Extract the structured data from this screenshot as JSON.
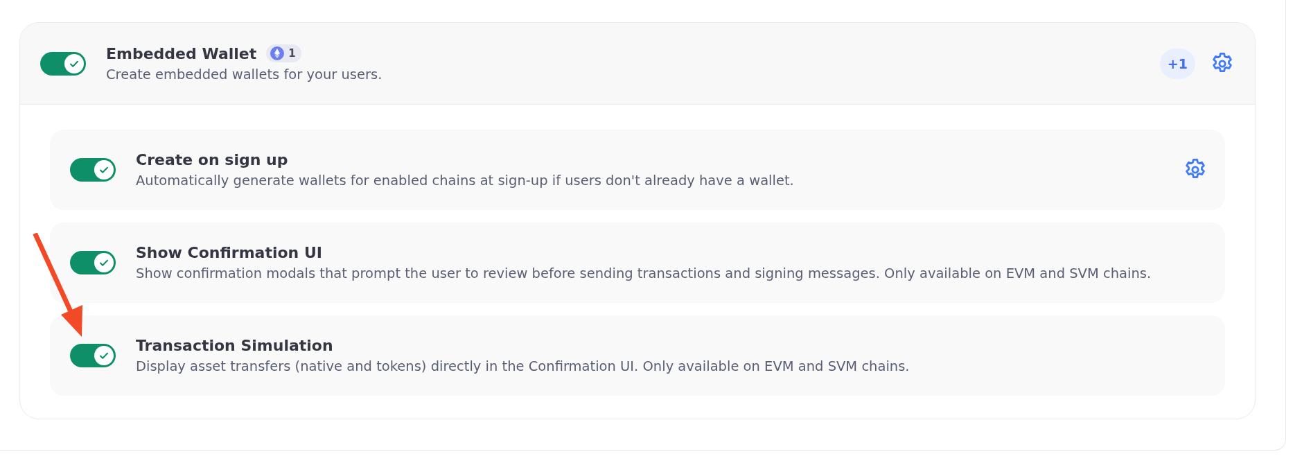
{
  "wallet": {
    "title": "Embedded Wallet",
    "on": true,
    "chain_count": "1",
    "description": "Create embedded wallets for your users.",
    "extra_badge": "+1"
  },
  "options": [
    {
      "title": "Create on sign up",
      "description": "Automatically generate wallets for enabled chains at sign-up if users don't already have a wallet.",
      "on": true,
      "settings": true
    },
    {
      "title": "Show Confirmation UI",
      "description": "Show confirmation modals that prompt the user to review before sending transactions and signing messages. Only available on EVM and SVM chains.",
      "on": true,
      "settings": false
    },
    {
      "title": "Transaction Simulation",
      "description": "Display asset transfers (native and tokens) directly in the Confirmation UI. Only available on EVM and SVM chains.",
      "on": true,
      "settings": false
    }
  ]
}
